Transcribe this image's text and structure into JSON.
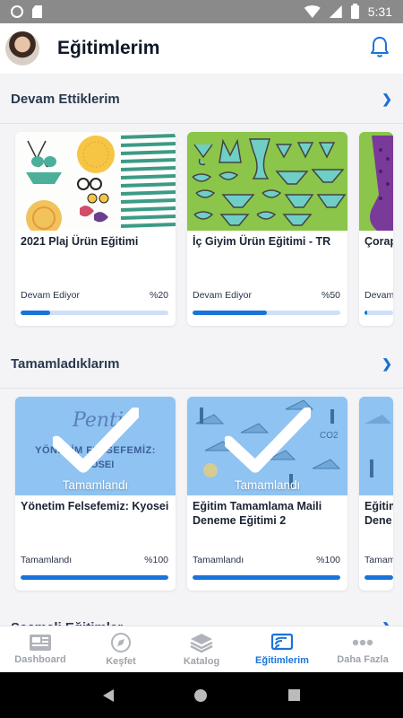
{
  "status_bar": {
    "time": "5:31"
  },
  "header": {
    "title": "Eğitimlerim"
  },
  "sections": {
    "continuing": {
      "title": "Devam Ettiklerim",
      "cards": [
        {
          "title": "2021 Plaj Ürün Eğitimi",
          "status": "Devam Ediyor",
          "percent_label": "%20",
          "progress": 0.2
        },
        {
          "title": "İç Giyim Ürün Eğitimi - TR",
          "status": "Devam Ediyor",
          "percent_label": "%50",
          "progress": 0.5
        },
        {
          "title": "Çorap",
          "status": "Devam",
          "percent_label": "",
          "progress": 0.1
        }
      ]
    },
    "completed": {
      "title": "Tamamladıklarım",
      "overlay_label": "Tamamlandı",
      "thumb_text": {
        "brand": "Penti",
        "line1": "YÖNETİM FELSEFEMİZ:",
        "line2": "KYOSEI",
        "co2": "CO2"
      },
      "cards": [
        {
          "title": "Yönetim Felsefemiz: Kyosei",
          "status": "Tamamlandı",
          "percent_label": "%100",
          "progress": 1.0
        },
        {
          "title": "Eğitim Tamamlama Maili Deneme Eğitimi 2",
          "status": "Tamamlandı",
          "percent_label": "%100",
          "progress": 1.0
        },
        {
          "title": "Eğitim Dene",
          "status": "Tamamlandı",
          "percent_label": "",
          "progress": 1.0
        }
      ]
    },
    "third": {
      "title": "Seçmeli Eğitimler"
    }
  },
  "bottom_nav": [
    {
      "label": "Dashboard",
      "icon": "dashboard-icon",
      "active": false
    },
    {
      "label": "Keşfet",
      "icon": "compass-icon",
      "active": false
    },
    {
      "label": "Katalog",
      "icon": "layers-icon",
      "active": false
    },
    {
      "label": "Eğitimlerim",
      "icon": "cast-icon",
      "active": true
    },
    {
      "label": "Daha Fazla",
      "icon": "more-icon",
      "active": false
    }
  ],
  "colors": {
    "accent": "#1a73d9",
    "progress_track": "#cfe0f6",
    "thumb_green": "#8bc549",
    "thumb_blue": "#8fc3f2"
  }
}
